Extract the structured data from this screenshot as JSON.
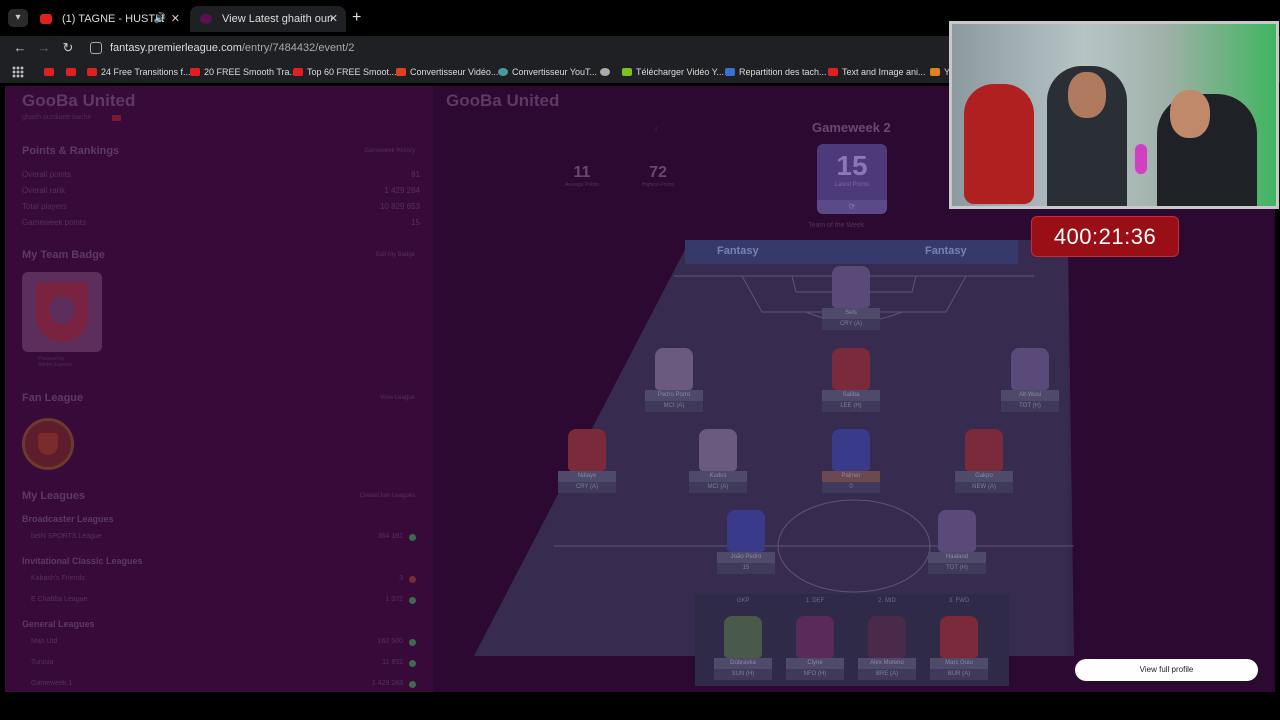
{
  "browser": {
    "tabs": [
      {
        "title": "(1) TAGNE - HUSTLER ft. A.J.",
        "audio": true
      },
      {
        "title": "View Latest ghaith ourdiane b",
        "active": true
      }
    ],
    "url_host": "fantasy.premierleague.com",
    "url_path": "/entry/7484432/event/2",
    "bookmarks": [
      "24 Free Transitions f...",
      "20 FREE Smooth Tra...",
      "Top 60 FREE Smoot...",
      "Convertisseur Vidéo...",
      "Convertisseur YouT...",
      "Télécharger Vidéo Y...",
      "Repartition des tach...",
      "Text and Image ani...",
      "Yo"
    ]
  },
  "sidebar": {
    "team_name": "GooBa United",
    "manager": "ghaith ourdiane bachir",
    "points_heading": "Points & Rankings",
    "gameweek_history": "Gameweek History",
    "rankings": [
      {
        "label": "Overall points",
        "value": "81"
      },
      {
        "label": "Overall rank",
        "value": "1 429 284"
      },
      {
        "label": "Total players",
        "value": "10 829 653"
      },
      {
        "label": "Gameweek points",
        "value": "15"
      }
    ],
    "badge_heading": "My Team Badge",
    "edit_badge": "Edit My Badge",
    "powered_by": "Powered by",
    "adobe": "Adobe Express",
    "fan_heading": "Fan League",
    "view_league": "View League",
    "leagues_heading": "My Leagues",
    "create_join": "Create/Join Leagues",
    "groups": [
      {
        "title": "Broadcaster Leagues",
        "items": [
          {
            "name": "beIN SPORTS League",
            "rank": "364 181"
          }
        ]
      },
      {
        "title": "Invitational Classic Leagues",
        "items": [
          {
            "name": "Kabash's Friends",
            "rank": "3"
          },
          {
            "name": "E Chabba League",
            "rank": "1 372"
          }
        ]
      },
      {
        "title": "General Leagues",
        "items": [
          {
            "name": "Man Utd",
            "rank": "162 500"
          },
          {
            "name": "Tunisia",
            "rank": "11 832"
          },
          {
            "name": "Gameweek 1",
            "rank": "1 429 283"
          }
        ]
      }
    ]
  },
  "main": {
    "team_name": "GooBa United",
    "gameweek": "Gameweek 2",
    "average_points": "11",
    "average_label": "Average Points",
    "highest_points": "72",
    "highest_label": "Highest Points",
    "latest_points": "15",
    "latest_label": "Latest Points",
    "team_of_week": "Team of the Week",
    "fantasy_brand": "Fantasy",
    "players": [
      {
        "name": "Sels",
        "fixture": "CRY (A)"
      },
      {
        "name": "Pedro Porro",
        "fixture": "MCI (A)"
      },
      {
        "name": "Saliba",
        "fixture": "LEE (H)"
      },
      {
        "name": "Alt-Wusi",
        "fixture": "TOT (H)"
      },
      {
        "name": "Ndiaye",
        "fixture": "CRY (A)"
      },
      {
        "name": "Kudus",
        "fixture": "MCI (A)"
      },
      {
        "name": "Palmer",
        "fixture": "0"
      },
      {
        "name": "Gakpo",
        "fixture": "NEW (A)"
      },
      {
        "name": "João Pedro",
        "fixture": "15"
      },
      {
        "name": "Haaland",
        "fixture": "TOT (H)"
      },
      {
        "name": "Dúbravka",
        "fixture": "SUN (H)"
      },
      {
        "name": "Clyne",
        "fixture": "NFO (H)"
      },
      {
        "name": "Alex Moreno",
        "fixture": "BRE (A)"
      },
      {
        "name": "Marc Guiu",
        "fixture": "BUR (A)"
      }
    ],
    "bench_labels": [
      "GKP",
      "1. DEF",
      "2. MID",
      "3. FWD"
    ]
  },
  "overlay": {
    "timer": "400:21:36",
    "view_profile": "View full profile"
  }
}
